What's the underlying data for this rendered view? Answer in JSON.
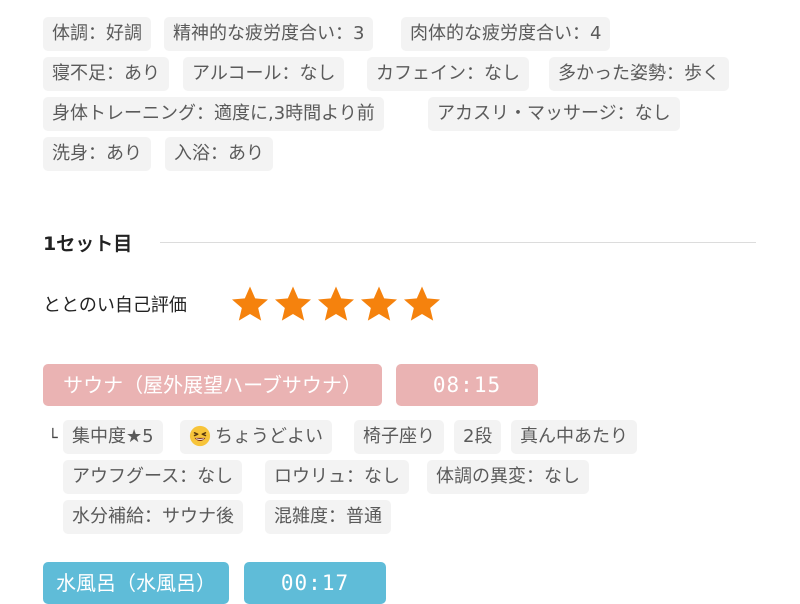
{
  "conditions": {
    "tags": [
      "体調：好調",
      "精神的な疲労度合い：3",
      "肉体的な疲労度合い：4",
      "寝不足：あり",
      "アルコール：なし",
      "カフェイン：なし",
      "多かった姿勢：歩く",
      "身体トレーニング：適度に,3時間より前",
      "アカスリ・マッサージ：なし",
      "洗身：あり",
      "入浴：あり"
    ]
  },
  "set1": {
    "title": "1セット目",
    "rating_label": "ととのい自己評価",
    "rating_stars": 5,
    "star_color": "#f5820d",
    "sauna": {
      "name": "サウナ（屋外展望ハーブサウナ）",
      "time": "08:15",
      "indent_mark": "└",
      "tags": [
        "集中度★5",
        "ちょうどよい",
        "椅子座り",
        "2段",
        "真ん中あたり",
        "アウフグース：なし",
        "ロウリュ：なし",
        "体調の異変：なし",
        "水分補給：サウナ後",
        "混雑度：普通"
      ],
      "color": "#eab3b3"
    },
    "water": {
      "name": "水風呂（水風呂）",
      "time": "00:17",
      "color": "#5fbcd8"
    }
  }
}
